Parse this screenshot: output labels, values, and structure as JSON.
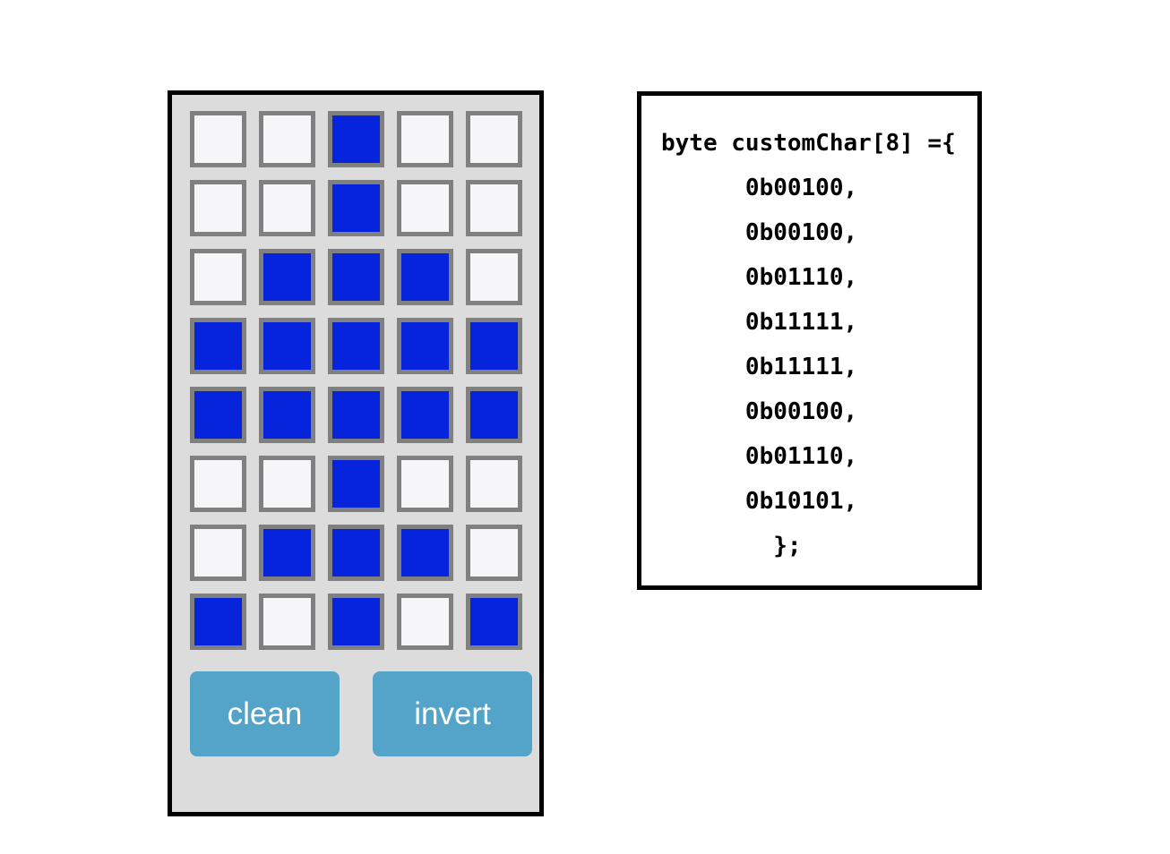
{
  "colors": {
    "page_background": "#ffffff",
    "panel_background": "#dcdcdc",
    "panel_border": "#000000",
    "cell_on": "#0524db",
    "cell_off": "#f6f6f8",
    "cell_border": "#808080",
    "button_background": "#54a3c8",
    "button_text": "#ffffff",
    "code_text": "#000000"
  },
  "editor": {
    "grid": {
      "rows": 8,
      "cols": 5,
      "matrix": [
        [
          0,
          0,
          1,
          0,
          0
        ],
        [
          0,
          0,
          1,
          0,
          0
        ],
        [
          0,
          1,
          1,
          1,
          0
        ],
        [
          1,
          1,
          1,
          1,
          1
        ],
        [
          1,
          1,
          1,
          1,
          1
        ],
        [
          0,
          0,
          1,
          0,
          0
        ],
        [
          0,
          1,
          1,
          1,
          0
        ],
        [
          1,
          0,
          1,
          0,
          1
        ]
      ]
    },
    "buttons": {
      "clean_label": "clean",
      "invert_label": "invert"
    }
  },
  "code": {
    "header_line": "byte customChar[8] ={",
    "value_lines": [
      "0b00100,",
      "0b00100,",
      "0b01110,",
      "0b11111,",
      "0b11111,",
      "0b00100,",
      "0b01110,",
      "0b10101,"
    ],
    "closing_line": "};",
    "text": "byte customChar[8] ={\n      0b00100,\n      0b00100,\n      0b01110,\n      0b11111,\n      0b11111,\n      0b00100,\n      0b01110,\n      0b10101,\n        };"
  }
}
